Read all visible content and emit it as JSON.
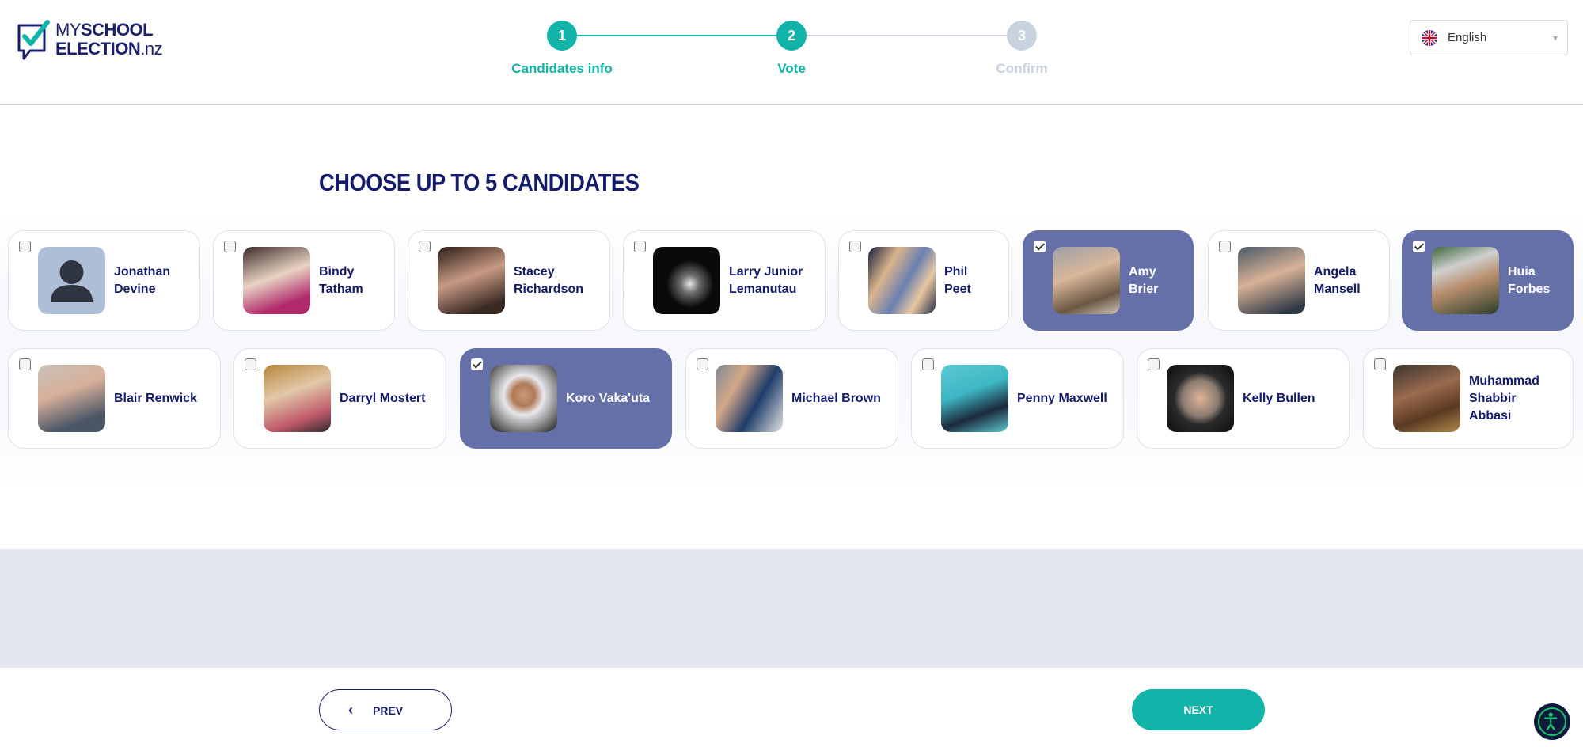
{
  "logo": {
    "line1_light": "MY",
    "line1_bold": "SCHOOL",
    "line2_bold": "ELECTION",
    "line2_light": ".nz"
  },
  "steps": [
    {
      "number": "1",
      "label": "Candidates info",
      "state": "done"
    },
    {
      "number": "2",
      "label": "Vote",
      "state": "active"
    },
    {
      "number": "3",
      "label": "Confirm",
      "state": "upcoming"
    }
  ],
  "language": {
    "selected": "English",
    "flag_icon": "uk-flag-icon"
  },
  "page_title": "CHOOSE UP TO 5 CANDIDATES",
  "candidates_row1": [
    {
      "name_lines": [
        "Jonathan",
        "Devine"
      ],
      "selected": false,
      "photo": "placeholder"
    },
    {
      "name_lines": [
        "Bindy",
        "Tatham"
      ],
      "selected": false,
      "photo": "portrait"
    },
    {
      "name_lines": [
        "Stacey",
        "Richardson"
      ],
      "selected": false,
      "photo": "portrait"
    },
    {
      "name_lines": [
        "Larry Junior",
        "Lemanutau"
      ],
      "selected": false,
      "photo": "stage"
    },
    {
      "name_lines": [
        "Phil",
        "Peet"
      ],
      "selected": false,
      "photo": "group"
    },
    {
      "name_lines": [
        "Amy",
        "Brier"
      ],
      "selected": true,
      "photo": "portrait"
    },
    {
      "name_lines": [
        "Angela",
        "Mansell"
      ],
      "selected": false,
      "photo": "portrait"
    },
    {
      "name_lines": [
        "Huia",
        "Forbes"
      ],
      "selected": true,
      "photo": "portrait"
    }
  ],
  "candidates_row2": [
    {
      "name_lines": [
        "Blair Renwick"
      ],
      "selected": false,
      "photo": "portrait"
    },
    {
      "name_lines": [
        "Darryl Mostert"
      ],
      "selected": false,
      "photo": "portrait"
    },
    {
      "name_lines": [
        "Koro Vaka'uta"
      ],
      "selected": true,
      "photo": "portrait"
    },
    {
      "name_lines": [
        "Michael Brown"
      ],
      "selected": false,
      "photo": "group"
    },
    {
      "name_lines": [
        "Penny Maxwell"
      ],
      "selected": false,
      "photo": "portrait"
    },
    {
      "name_lines": [
        "Kelly Bullen"
      ],
      "selected": false,
      "photo": "portrait"
    },
    {
      "name_lines": [
        "Muhammad",
        "Shabbir",
        "Abbasi"
      ],
      "selected": false,
      "photo": "portrait"
    }
  ],
  "buttons": {
    "prev": "PREV",
    "next": "NEXT"
  },
  "colors": {
    "navy": "#141b6a",
    "teal": "#12b3a8",
    "selected_card": "#6570a8",
    "step_inactive": "#c9d3e0"
  }
}
